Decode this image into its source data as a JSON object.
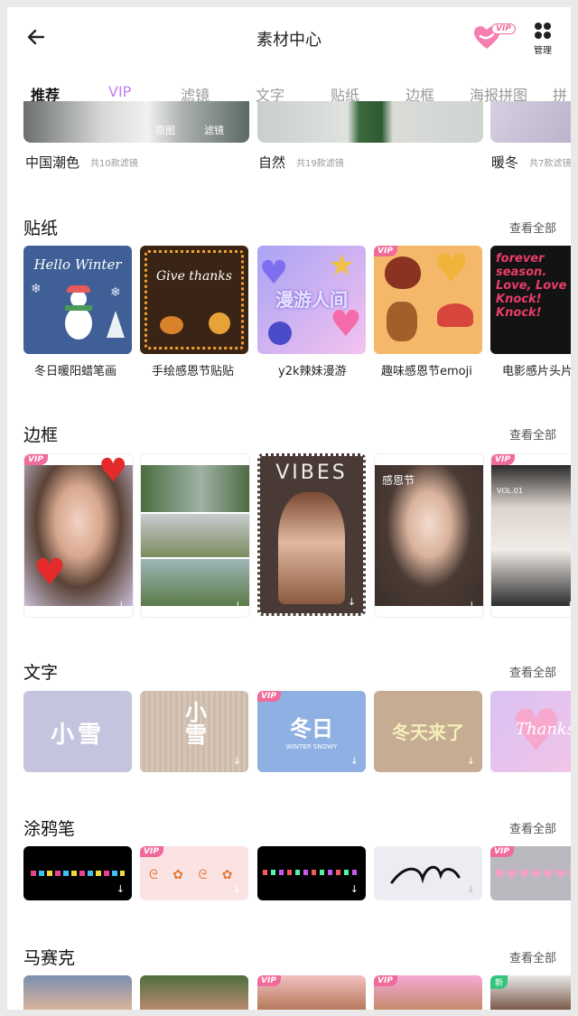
{
  "header": {
    "title": "素材中心",
    "vip_badge": "VIP",
    "manage_label": "管理"
  },
  "tabs": [
    "推荐",
    "VIP",
    "滤镜",
    "文字",
    "贴纸",
    "边框",
    "海报拼图",
    "拼"
  ],
  "filters": {
    "overlay_labels": [
      "原图",
      "滤镜"
    ],
    "items": [
      {
        "name": "中国潮色",
        "count": "共10款滤镜"
      },
      {
        "name": "自然",
        "count": "共19款滤镜"
      },
      {
        "name": "暖冬",
        "count": "共7款滤镜"
      }
    ]
  },
  "stickers": {
    "title": "贴纸",
    "see_all": "查看全部",
    "items": [
      {
        "label": "冬日暖阳蜡笔画",
        "art": "Hello Winter"
      },
      {
        "label": "手绘感恩节贴贴",
        "art": "Give thanks"
      },
      {
        "label": "y2k辣妹漫游",
        "art": "漫游人间"
      },
      {
        "label": "趣味感恩节emoji",
        "vip": "VIP"
      },
      {
        "label": "电影感片头片",
        "art": "forever season. Love, Love Knock! Knock!"
      }
    ]
  },
  "frames": {
    "title": "边框",
    "see_all": "查看全部",
    "vip": "VIP",
    "art_vibes": "VIBES",
    "art_thanks": "感恩节",
    "art_vol": "VOL.01"
  },
  "text": {
    "title": "文字",
    "see_all": "查看全部",
    "vip": "VIP",
    "art": [
      "小雪",
      "小雪",
      "冬日",
      "冬天来了",
      "Thanks"
    ],
    "sub": "WINTER SNOWY"
  },
  "brush": {
    "title": "涂鸦笔",
    "see_all": "查看全部",
    "vip": "VIP"
  },
  "mosaic": {
    "title": "马赛克",
    "see_all": "查看全部",
    "vip": "VIP",
    "new": "新"
  },
  "colors": {
    "accent_pink": "#f06b9b",
    "vip_purple": "#c47ef0"
  }
}
